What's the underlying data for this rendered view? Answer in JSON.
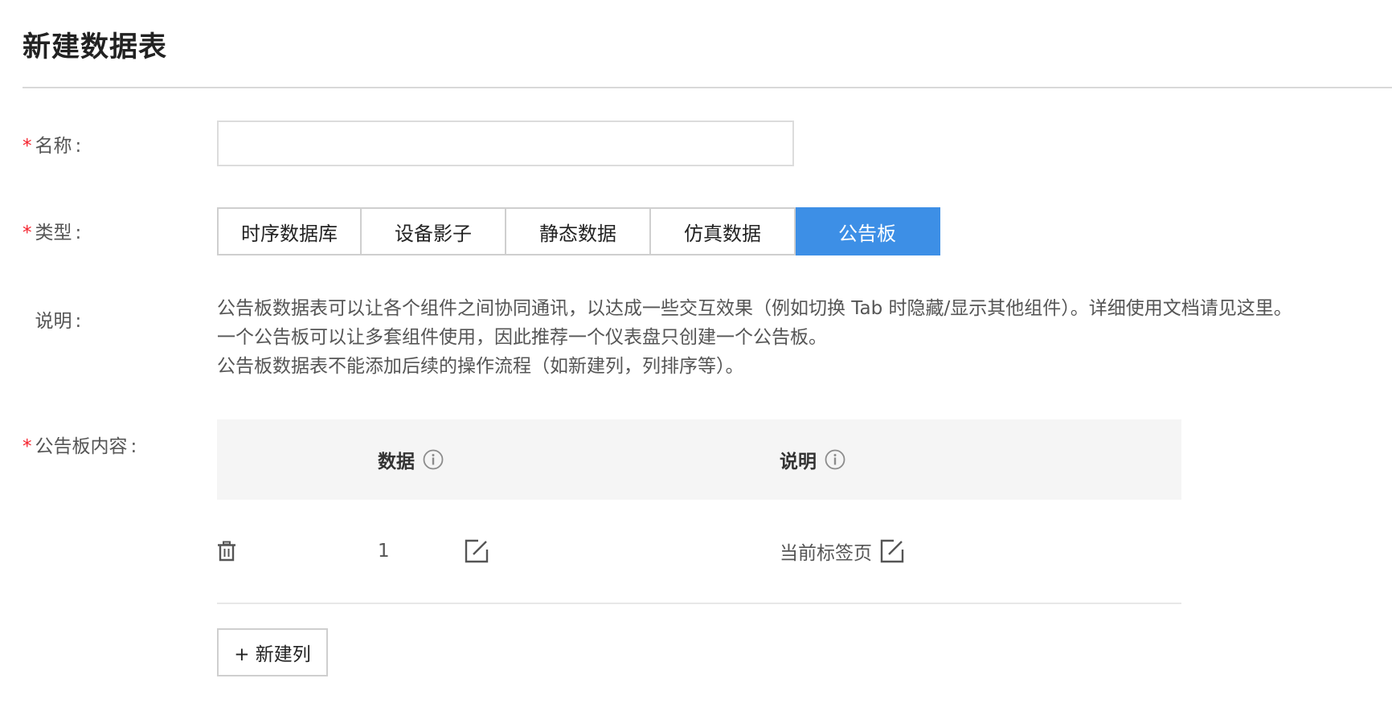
{
  "page": {
    "title": "新建数据表"
  },
  "form": {
    "name": {
      "label": "名称",
      "required": true,
      "value": "",
      "placeholder": ""
    },
    "type": {
      "label": "类型",
      "required": true,
      "options": [
        "时序数据库",
        "设备影子",
        "静态数据",
        "仿真数据",
        "公告板"
      ],
      "selected": "公告板"
    },
    "description": {
      "label": "说明",
      "lines": [
        "公告板数据表可以让各个组件之间协同通讯，以达成一些交互效果（例如切换 Tab 时隐藏/显示其他组件）。详细使用文档请见这里。",
        "一个公告板可以让多套组件使用，因此推荐一个仪表盘只创建一个公告板。",
        "公告板数据表不能添加后续的操作流程（如新建列，列排序等）。"
      ]
    },
    "board_content": {
      "label": "公告板内容",
      "required": true,
      "columns": [
        "数据",
        "说明"
      ],
      "rows": [
        {
          "data": "1",
          "note": "当前标签页"
        }
      ],
      "add_button": "+ 新建列"
    }
  },
  "colors": {
    "accent": "#3d8fe6",
    "required": "#f5222d",
    "divider": "#d9d9d9"
  },
  "icons": [
    "info-icon",
    "trash-icon",
    "edit-icon"
  ]
}
